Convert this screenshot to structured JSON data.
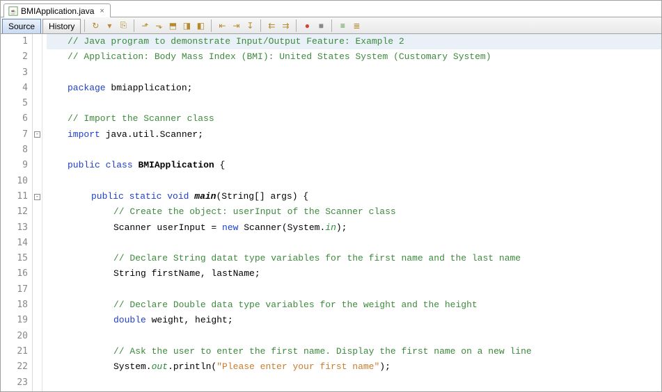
{
  "tab": {
    "filename": "BMIApplication.java"
  },
  "subtabs": {
    "source": "Source",
    "history": "History"
  },
  "toolbar_icons": [
    "refresh-icon",
    "dropdown-icon",
    "pin-icon",
    "sep",
    "find-sel-prev-icon",
    "find-sel-next-icon",
    "toggle-hl-icon",
    "prev-bookmark-icon",
    "next-bookmark-icon",
    "sep",
    "shift-left-icon",
    "shift-right-icon",
    "reformat-icon",
    "sep",
    "comment-icon",
    "uncomment-icon",
    "sep",
    "stop-icon",
    "record-icon",
    "sep",
    "diff-prev-icon",
    "diff-next-icon"
  ],
  "code": [
    {
      "n": 1,
      "fold": "",
      "html": "<span class='cmt-doc'>// Java program to demonstrate Input&#47;Output Feature: Example 2</span>",
      "cls": "hl0 ind1"
    },
    {
      "n": 2,
      "fold": "",
      "html": "<span class='cmt-doc'>// Application: Body Mass Index (BMI): United States System (Customary System)</span>",
      "cls": "ind1"
    },
    {
      "n": 3,
      "fold": "",
      "html": "",
      "cls": ""
    },
    {
      "n": 4,
      "fold": "",
      "html": "<span class='kw'>package</span> bmiapplication;",
      "cls": "ind1"
    },
    {
      "n": 5,
      "fold": "",
      "html": "",
      "cls": ""
    },
    {
      "n": 6,
      "fold": "",
      "html": "<span class='cmt-doc'>// Import the Scanner class</span>",
      "cls": "ind1"
    },
    {
      "n": 7,
      "fold": "-",
      "html": "<span class='kw'>import</span> java.util.Scanner;",
      "cls": "ind1"
    },
    {
      "n": 8,
      "fold": "",
      "html": "",
      "cls": ""
    },
    {
      "n": 9,
      "fold": "",
      "html": "<span class='kw'>public</span> <span class='kw'>class</span> <span class='typ'>BMIApplication</span> {",
      "cls": "ind1"
    },
    {
      "n": 10,
      "fold": "",
      "html": "",
      "cls": ""
    },
    {
      "n": 11,
      "fold": "-",
      "html": "<span class='kw'>public</span> <span class='kw'>static</span> <span class='kw'>void</span> <span class='mth'>main</span>(String[] args) {",
      "cls": "ind2"
    },
    {
      "n": 12,
      "fold": "",
      "html": "<span class='cmt-doc'>// Create the object: userInput of the Scanner class</span>",
      "cls": "ind3"
    },
    {
      "n": 13,
      "fold": "",
      "html": "Scanner userInput = <span class='kw'>new</span> Scanner(System.<span class='fld'>in</span>);",
      "cls": "ind3"
    },
    {
      "n": 14,
      "fold": "",
      "html": "",
      "cls": ""
    },
    {
      "n": 15,
      "fold": "",
      "html": "<span class='cmt-doc'>// Declare String datat type variables for the first name and the last name</span>",
      "cls": "ind3"
    },
    {
      "n": 16,
      "fold": "",
      "html": "String firstName, lastName;",
      "cls": "ind3"
    },
    {
      "n": 17,
      "fold": "",
      "html": "",
      "cls": ""
    },
    {
      "n": 18,
      "fold": "",
      "html": "<span class='cmt-doc'>// Declare Double data type variables for the weight and the height</span>",
      "cls": "ind3"
    },
    {
      "n": 19,
      "fold": "",
      "html": "<span class='kw'>double</span> weight, height;",
      "cls": "ind3"
    },
    {
      "n": 20,
      "fold": "",
      "html": "",
      "cls": ""
    },
    {
      "n": 21,
      "fold": "",
      "html": "<span class='cmt-doc'>// Ask the user to enter the first name. Display the first name on a new line</span>",
      "cls": "ind3"
    },
    {
      "n": 22,
      "fold": "",
      "html": "System.<span class='fld'>out</span>.println(<span class='str'>\"Please enter your first name\"</span>);",
      "cls": "ind3"
    },
    {
      "n": 23,
      "fold": "",
      "html": "",
      "cls": ""
    }
  ]
}
